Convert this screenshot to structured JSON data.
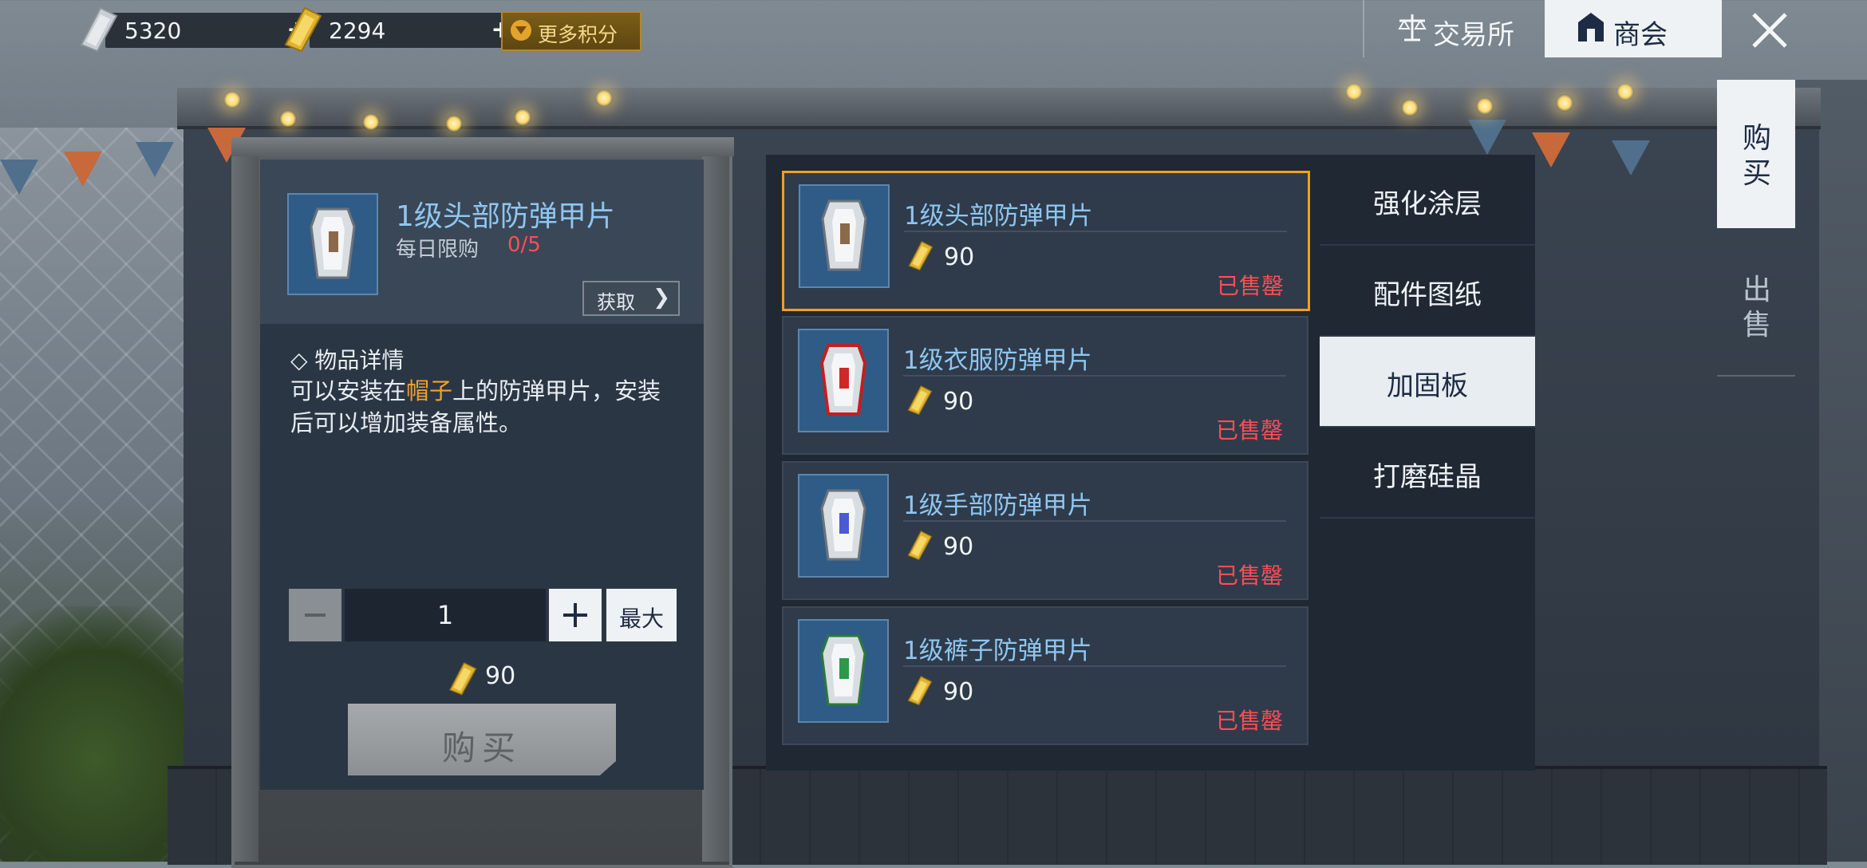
{
  "currencies": [
    {
      "value": "5320",
      "icon": "silver-ticket-icon",
      "plus": "+"
    },
    {
      "value": "2294",
      "icon": "gold-ticket-icon",
      "plus": "+"
    }
  ],
  "more_points_label": "更多积分",
  "nav": {
    "exchange": "交易所",
    "guild": "商会"
  },
  "side_tabs": {
    "buy": "购买",
    "sell": "出售"
  },
  "detail": {
    "name": "1级头部防弹甲片",
    "limit_label": "每日限购",
    "limit_value": "0/5",
    "get_label": "获取",
    "section_title": "◇ 物品详情",
    "desc_before": "可以安装在",
    "desc_highlight": "帽子",
    "desc_after": "上的防弹甲片，安装后可以增加装备属性。",
    "quantity": "1",
    "max_label": "最大",
    "total_price": "90",
    "buy_label": "购买"
  },
  "items": [
    {
      "name": "1级头部防弹甲片",
      "price": "90",
      "status": "已售罄",
      "accent": "#8a6a4a"
    },
    {
      "name": "1级衣服防弹甲片",
      "price": "90",
      "status": "已售罄",
      "accent": "#d02828"
    },
    {
      "name": "1级手部防弹甲片",
      "price": "90",
      "status": "已售罄",
      "accent": "#4a5ad0"
    },
    {
      "name": "1级裤子防弹甲片",
      "price": "90",
      "status": "已售罄",
      "accent": "#2a9a4a"
    }
  ],
  "categories": [
    {
      "label": "强化涂层",
      "active": false
    },
    {
      "label": "配件图纸",
      "active": false
    },
    {
      "label": "加固板",
      "active": true
    },
    {
      "label": "打磨硅晶",
      "active": false
    }
  ],
  "colors": {
    "accent_selected": "#f0a020",
    "sold_out": "#ff4d55",
    "item_name": "#8ec6f0"
  }
}
